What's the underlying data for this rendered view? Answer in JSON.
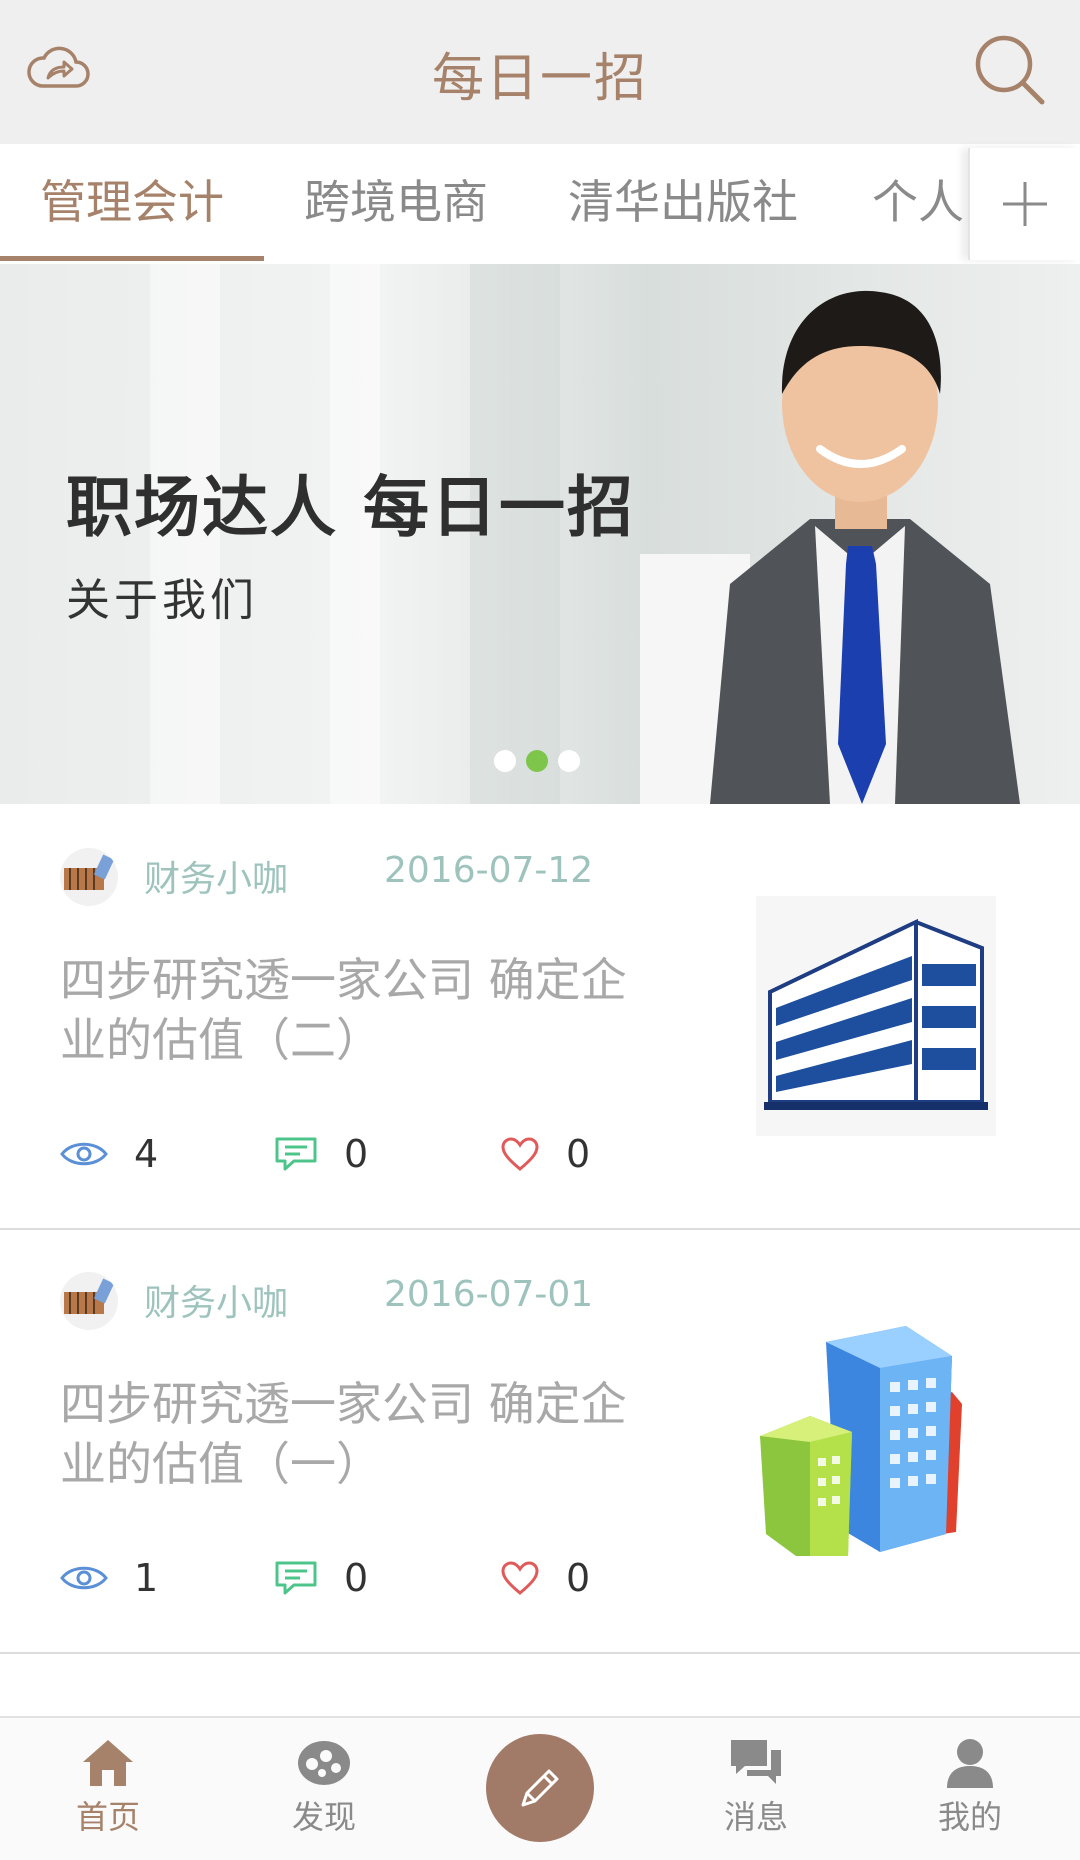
{
  "header": {
    "title": "每日一招",
    "left_icon": "cloud-share-icon",
    "right_icon": "search-icon",
    "accent_color": "#a6826a"
  },
  "tabs": [
    {
      "label": "管理会计",
      "active": true
    },
    {
      "label": "跨境电商",
      "active": false
    },
    {
      "label": "清华出版社",
      "active": false
    },
    {
      "label": "个人",
      "active": false
    }
  ],
  "tab_add_icon": "plus-icon",
  "banner": {
    "headline": "职场达人 每日一招",
    "subtitle": "关于我们",
    "active_slide": 2,
    "slide_count": 3,
    "dot_active_color": "#7ec64b"
  },
  "articles": [
    {
      "author": "财务小咖",
      "date": "2016-07-12",
      "title": "四步研究透一家公司 确定企业的估值（二）",
      "views": "4",
      "comments": "0",
      "likes": "0",
      "thumb_icon": "office-building-icon"
    },
    {
      "author": "财务小咖",
      "date": "2016-07-01",
      "title": "四步研究透一家公司 确定企业的估值（一）",
      "views": "1",
      "comments": "0",
      "likes": "0",
      "thumb_icon": "colorful-buildings-icon"
    }
  ],
  "bottom_nav": {
    "home": "首页",
    "discover": "发现",
    "compose_icon": "pencil-icon",
    "messages": "消息",
    "mine": "我的"
  }
}
